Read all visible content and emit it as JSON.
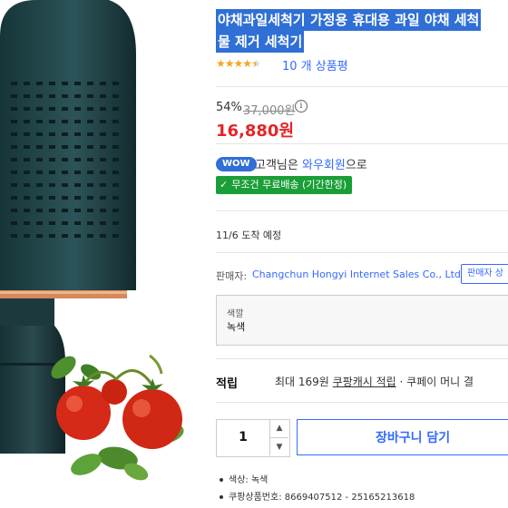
{
  "product": {
    "title_line1": "야채과일세척기 가정용 휴대용 과일 야채 세척",
    "title_line2": "물 제거 세척기",
    "rating_stars": 4.5,
    "review_count_text": "10 개 상품평"
  },
  "price": {
    "discount": "54%",
    "original": "37,000원",
    "info_icon": "info-icon",
    "sale": "16,880원"
  },
  "membership": {
    "badge": "WOW",
    "text_prefix": "고객님은 ",
    "member_label": "와우회원",
    "text_suffix": "으로"
  },
  "shipping": {
    "check_icon": "check-icon",
    "free_label": "무조건 무료배송 (기간한정)",
    "eta": "11/6 도착 예정"
  },
  "seller": {
    "label": "판매자:",
    "name": "Changchun Hongyi Internet Sales Co., Ltd.",
    "button": "판매자 상"
  },
  "option": {
    "label": "색깔",
    "value": "녹색"
  },
  "reward": {
    "title": "적립",
    "max": "최대 169원 ",
    "cash": "쿠팡캐시 적립",
    "rest": " · 쿠페이 머니 결"
  },
  "purchase": {
    "quantity": "1",
    "up_icon": "▲",
    "down_icon": "▼",
    "cart_button": "장바구니 담기"
  },
  "details": [
    "색상: 녹색",
    "쿠팡상품번호: 8669407512 - 25165213618"
  ],
  "colors": {
    "accent_blue": "#346aff",
    "price_red": "#e52528",
    "ship_green": "#1a9e37",
    "product_teal": "#1f3f43"
  }
}
